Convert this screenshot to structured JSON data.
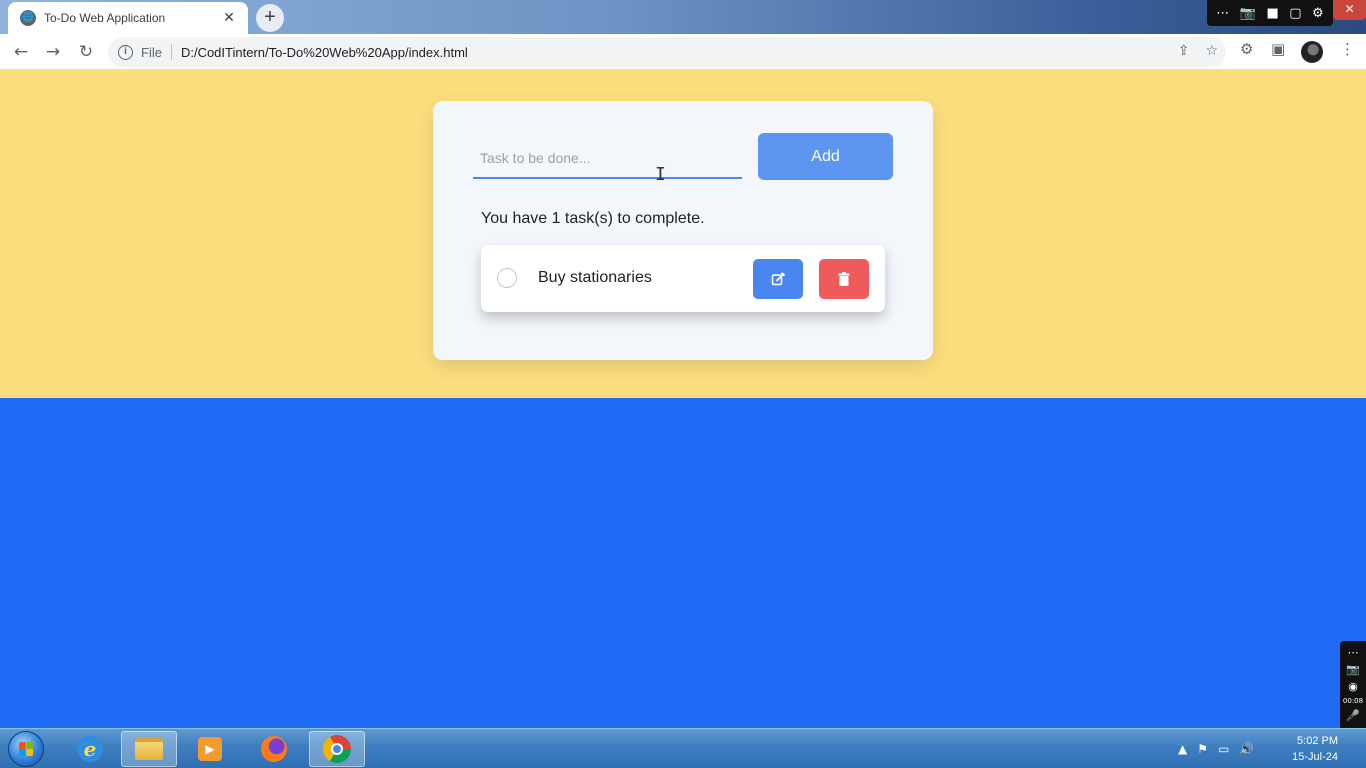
{
  "browser": {
    "tab_title": "To-Do Web Application",
    "tab_close": "✕",
    "new_tab": "+",
    "favicon": "globe-icon",
    "address": {
      "info": "i",
      "scheme_label": "File",
      "url": "D:/CodITintern/To-Do%20Web%20App/index.html"
    },
    "nav": {
      "back": "←",
      "forward": "→",
      "reload": "↻"
    },
    "toolbar_icons": {
      "share": "⇪",
      "bookmark": "☆",
      "extensions": "⚙",
      "sidepanel": "▣",
      "menu": "⋮"
    },
    "overlay_icons": [
      "⋯",
      "📷",
      "■",
      "▢",
      "⚙"
    ],
    "window_close": "✕"
  },
  "app": {
    "input_placeholder": "Task to be done...",
    "input_value": "",
    "add_label": "Add",
    "count_text": "You have 1 task(s) to complete.",
    "tasks": [
      {
        "label": "Buy stationaries",
        "completed": false
      }
    ],
    "colors": {
      "page_top": "#fbdf7e",
      "page_bottom": "#1f6bf5",
      "card": "#f3f7fb",
      "add_button": "#5c96f0",
      "edit_button": "#4a86f0",
      "delete_button": "#ef5b5b"
    },
    "icons": {
      "edit": "edit-icon",
      "delete": "trash-icon"
    }
  },
  "recorder": {
    "icons": [
      "⋯",
      "📷",
      "◉"
    ],
    "time": "00:08",
    "mic": "🎤"
  },
  "taskbar": {
    "apps": [
      "internet-explorer",
      "file-explorer",
      "media-player",
      "firefox",
      "chrome"
    ],
    "tray_icons": [
      "▲",
      "⚑",
      "▭",
      "🔊"
    ],
    "time": "5:02 PM",
    "date": "15-Jul-24"
  }
}
